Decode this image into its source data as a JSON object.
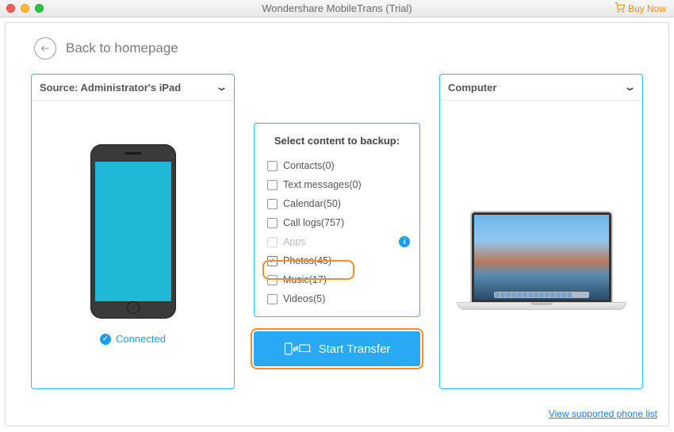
{
  "titlebar": {
    "title": "Wondershare MobileTrans (Trial)",
    "buy_label": "Buy Now"
  },
  "nav": {
    "back_label": "Back to homepage"
  },
  "source": {
    "title": "Source: Administrator's iPad",
    "status_label": "Connected"
  },
  "destination": {
    "title": "Computer"
  },
  "select": {
    "title": "Select content to backup:",
    "items": [
      {
        "label": "Contacts(0)",
        "checked": false,
        "disabled": false
      },
      {
        "label": "Text messages(0)",
        "checked": false,
        "disabled": false
      },
      {
        "label": "Calendar(50)",
        "checked": false,
        "disabled": false
      },
      {
        "label": "Call logs(757)",
        "checked": false,
        "disabled": false
      },
      {
        "label": "Apps",
        "checked": false,
        "disabled": true
      },
      {
        "label": "Photos(45)",
        "checked": true,
        "disabled": false
      },
      {
        "label": "Music(17)",
        "checked": false,
        "disabled": false
      },
      {
        "label": "Videos(5)",
        "checked": false,
        "disabled": false
      }
    ]
  },
  "actions": {
    "start_label": "Start Transfer"
  },
  "footer": {
    "supported_link": "View supported phone list"
  },
  "colors": {
    "accent": "#29bced",
    "primary_blue": "#2aa9f3",
    "highlight_orange": "#ff8a2a",
    "buy_orange": "#ff8a00"
  }
}
